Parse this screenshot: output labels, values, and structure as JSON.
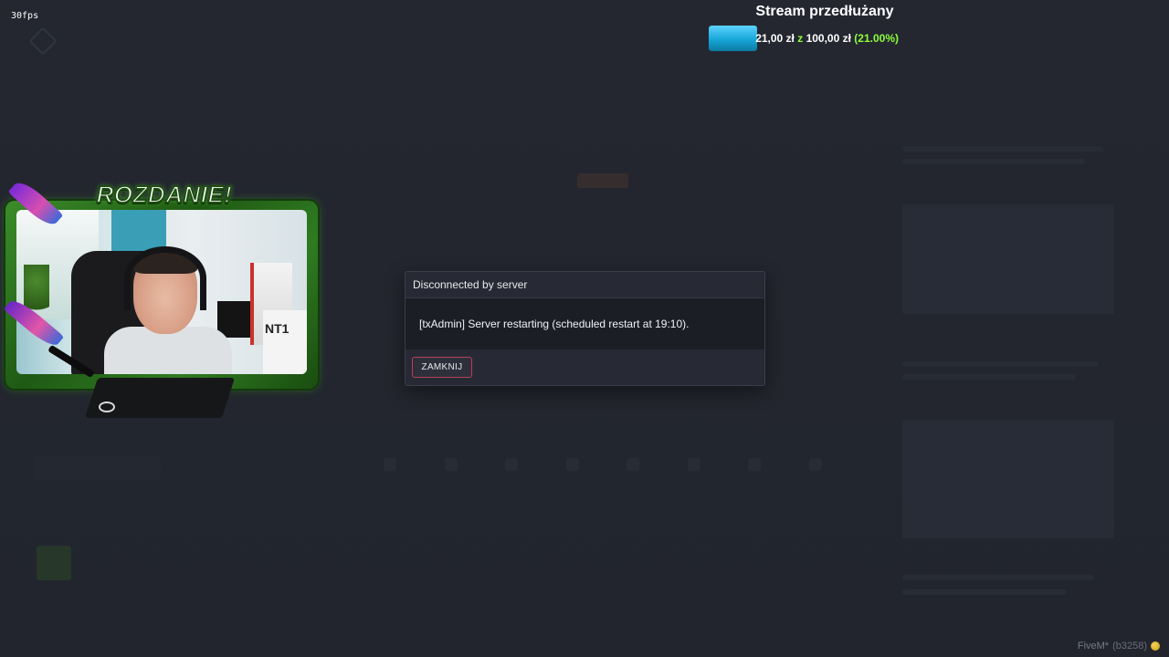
{
  "overlay": {
    "fps": "30fps"
  },
  "stream_goal": {
    "title": "Stream przedłużany",
    "current": "21,00 zł",
    "separator": "z",
    "target": "100,00 zł",
    "percent_text": "(21.00%)",
    "progress": 0.21,
    "bar_color": "#16a6d8",
    "percent_color": "#8dff3a"
  },
  "webcam": {
    "banner": "ROZDANIE!",
    "box_label": "NT1",
    "frame_color": "#2f7b21"
  },
  "dialog": {
    "title": "Disconnected by server",
    "message": "[txAdmin] Server restarting (scheduled restart at 19:10).",
    "close_label": "ZAMKNIJ",
    "accent_color": "#b5405a"
  },
  "footer": {
    "app": "FiveM*",
    "build": "(b3258)"
  }
}
